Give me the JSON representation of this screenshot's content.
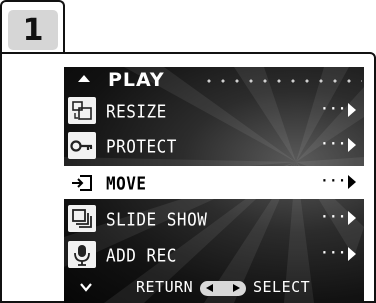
{
  "step": {
    "number": "1"
  },
  "menu": {
    "title": "PLAY",
    "items": [
      {
        "label": "RESIZE",
        "icon": "resize-icon",
        "arrow": "···",
        "selected": false
      },
      {
        "label": "PROTECT",
        "icon": "key-icon",
        "arrow": "···",
        "selected": false
      },
      {
        "label": "MOVE",
        "icon": "move-icon",
        "arrow": "···",
        "selected": true
      },
      {
        "label": "SLIDE SHOW",
        "icon": "slideshow-icon",
        "arrow": "···",
        "selected": false
      },
      {
        "label": "ADD REC",
        "icon": "microphone-icon",
        "arrow": "···",
        "selected": false
      }
    ]
  },
  "footer": {
    "return_label": "RETURN",
    "select_label": "SELECT"
  },
  "colors": {
    "screen_bg": "#121212",
    "highlight": "#ffffff",
    "text": "#ffffff",
    "step_badge": "#d6d6d6"
  }
}
